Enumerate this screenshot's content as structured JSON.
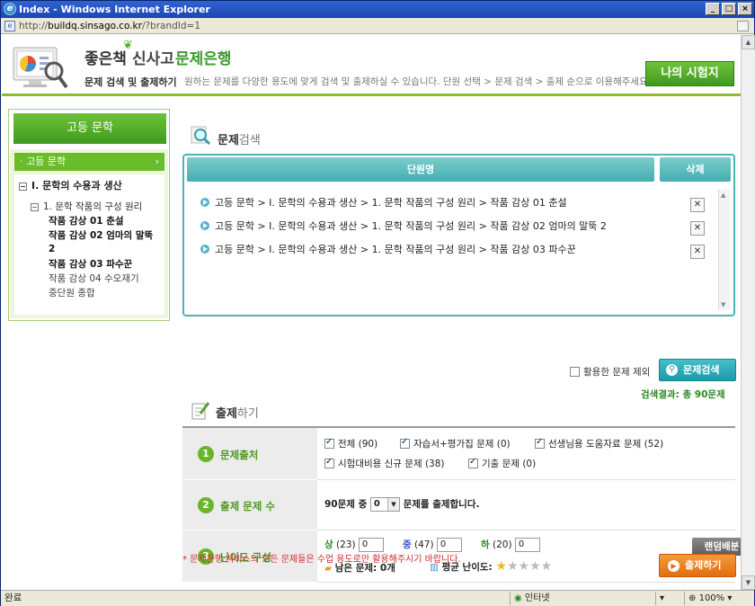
{
  "window": {
    "title": "Index - Windows Internet Explorer",
    "address_host": "buildq.sinsago.co.kr",
    "address_prefix": "http://",
    "address_path": "/?brandId=1"
  },
  "header": {
    "brand_part1": "좋은책",
    "brand_part2": "신사고",
    "brand_part3": "문제은행",
    "subtitle": "문제 검색 및 출제하기",
    "description": "원하는 문제를 다양한 용도에 맞게 검색 및 출제하실 수 있습니다. 단원 선택 > 문제 검색 > 출제 순으로 이용해주세요.",
    "my_test_button": "나의 시험지"
  },
  "sidebar": {
    "heading": "고등 문학",
    "selected": "고등 문학",
    "tree": {
      "level1": "I. 문학의 수용과 생산",
      "level2": "1. 문학 작품의 구성 원리",
      "items": [
        {
          "label": "작품 감상 01 춘설",
          "bold": true
        },
        {
          "label": "작품 감상 02 엄마의 말뚝 2",
          "bold": true
        },
        {
          "label": "작품 감상 03 파수꾼",
          "bold": true
        },
        {
          "label": "작품 감상 04 수오재기",
          "bold": false
        },
        {
          "label": "중단원 종합",
          "bold": false
        }
      ]
    }
  },
  "search": {
    "title_bold": "문제",
    "title_rest": "검색",
    "col_unit": "단원명",
    "col_delete": "삭제",
    "rows": [
      "고등 문학 > I. 문학의 수용과 생산 > 1. 문학 작품의 구성 원리 > 작품 감상 01 춘설",
      "고등 문학 > I. 문학의 수용과 생산 > 1. 문학 작품의 구성 원리 > 작품 감상 02 엄마의 말뚝 2",
      "고등 문학 > I. 문학의 수용과 생산 > 1. 문학 작품의 구성 원리 > 작품 감상 03 파수꾼"
    ],
    "delete_symbol": "✕",
    "exclude_label": "활용한 문제 제외",
    "button": "문제검색",
    "result": "검색결과: 총 90문제"
  },
  "chul": {
    "title_bold": "출제",
    "title_rest": "하기",
    "source": {
      "label": "문제출처",
      "options": [
        {
          "label": "전체 (90)",
          "checked": true
        },
        {
          "label": "자습서+평가집 문제 (0)",
          "checked": true
        },
        {
          "label": "선생님용 도움자료 문제 (52)",
          "checked": true
        },
        {
          "label": "시험대비용 신규 문제 (38)",
          "checked": true
        },
        {
          "label": "기출 문제 (0)",
          "checked": true
        }
      ]
    },
    "count": {
      "label": "출제 문제 수",
      "prefix": "90문제 중",
      "value": "0",
      "suffix": "문제를 출제합니다."
    },
    "difficulty": {
      "label": "난이도 구성",
      "high": "상",
      "high_count": "(23)",
      "high_value": "0",
      "mid": "중",
      "mid_count": "(47)",
      "mid_value": "0",
      "low": "하",
      "low_count": "(20)",
      "low_value": "0",
      "random_button": "랜덤배분",
      "remaining_label": "남은 문제:",
      "remaining_value": "0개",
      "avg_label": "평균 난이도:",
      "avg_stars": 1,
      "max_stars": 5
    }
  },
  "notice": "* 문제은행 서비스의 모든 문제들은 수업 용도로만 활용해주시기 바랍니다.",
  "submit_button": "출제하기",
  "statusbar": {
    "left": "완료",
    "zone": "인터넷",
    "zoom": "100%"
  },
  "colors": {
    "green": "#3f9a1f",
    "teal": "#42aeb0",
    "orange": "#e26e10",
    "red": "#d3282a"
  }
}
